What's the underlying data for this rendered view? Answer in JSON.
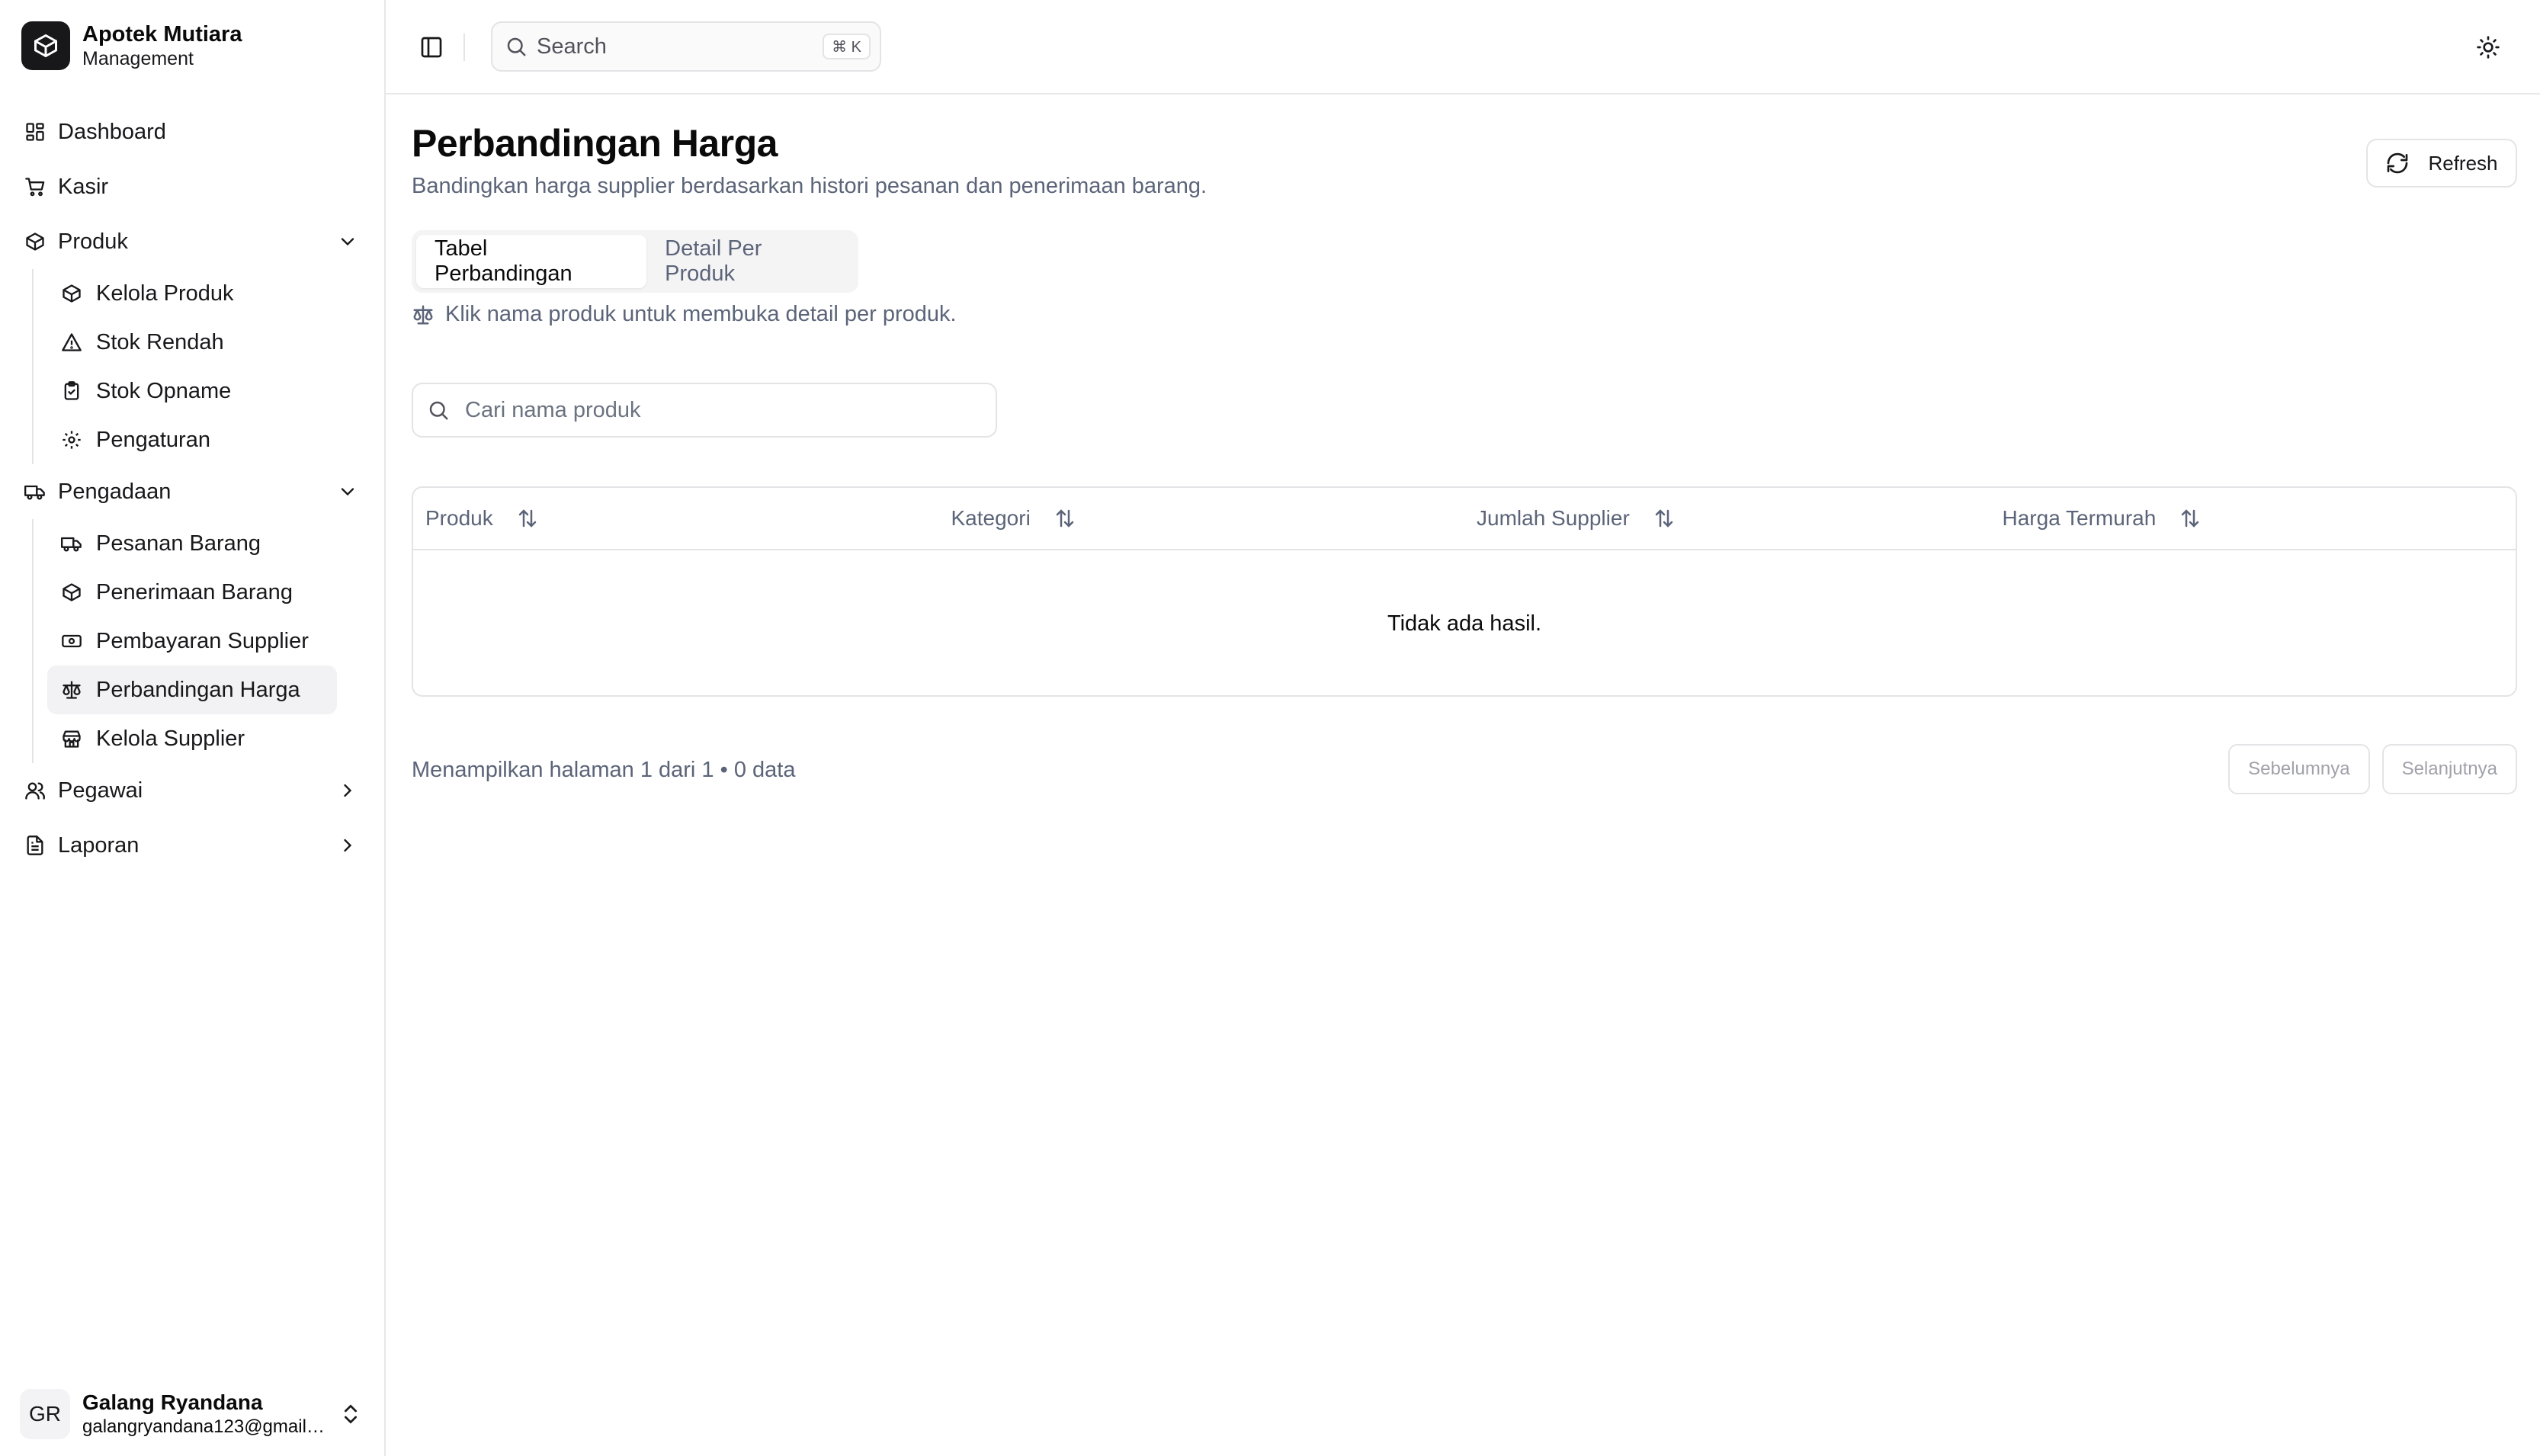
{
  "brand": {
    "name": "Apotek Mutiara",
    "subtitle": "Management"
  },
  "nav": {
    "dashboard": "Dashboard",
    "kasir": "Kasir",
    "produk": {
      "label": "Produk",
      "items": [
        "Kelola Produk",
        "Stok Rendah",
        "Stok Opname",
        "Pengaturan"
      ]
    },
    "pengadaan": {
      "label": "Pengadaan",
      "items": [
        "Pesanan Barang",
        "Penerimaan Barang",
        "Pembayaran Supplier",
        "Perbandingan Harga",
        "Kelola Supplier"
      ],
      "active": "Perbandingan Harga"
    },
    "pegawai": "Pegawai",
    "laporan": "Laporan"
  },
  "user": {
    "initials": "GR",
    "name": "Galang Ryandana",
    "email": "galangryandana123@gmail.com"
  },
  "topbar": {
    "search_placeholder": "Search",
    "shortcut": "⌘ K"
  },
  "page": {
    "title": "Perbandingan Harga",
    "subtitle": "Bandingkan harga supplier berdasarkan histori pesanan dan penerimaan barang.",
    "refresh_label": "Refresh",
    "tabs": [
      "Tabel Perbandingan",
      "Detail Per Produk"
    ],
    "active_tab": "Tabel Perbandingan",
    "hint": "Klik nama produk untuk membuka detail per produk.",
    "filter_placeholder": "Cari nama produk"
  },
  "table": {
    "columns": [
      "Produk",
      "Kategori",
      "Jumlah Supplier",
      "Harga Termurah"
    ],
    "rows": [],
    "empty_text": "Tidak ada hasil."
  },
  "pagination": {
    "summary": "Menampilkan halaman 1 dari 1 • 0 data",
    "prev_label": "Sebelumnya",
    "next_label": "Selanjutnya"
  }
}
